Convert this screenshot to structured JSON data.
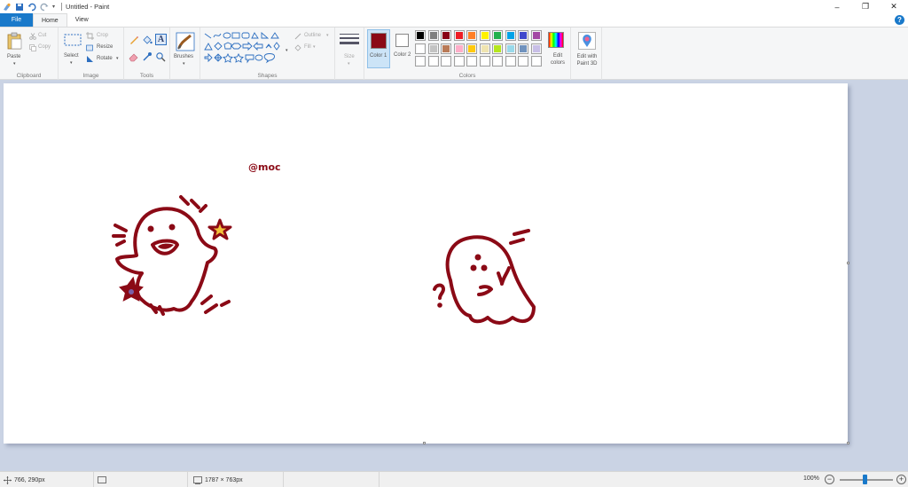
{
  "titlebar": {
    "title": "Untitled - Paint",
    "minimize": "–",
    "maximize": "❐",
    "close": "✕"
  },
  "tabs": {
    "file": "File",
    "home": "Home",
    "view": "View"
  },
  "ribbon": {
    "clipboard": {
      "label": "Clipboard",
      "paste": "Paste",
      "cut": "Cut",
      "copy": "Copy"
    },
    "image": {
      "label": "Image",
      "select": "Select",
      "crop": "Crop",
      "resize": "Resize",
      "rotate": "Rotate"
    },
    "tools": {
      "label": "Tools"
    },
    "brushes": {
      "label": "Brushes"
    },
    "shapes": {
      "label": "Shapes",
      "outline": "Outline",
      "fill": "Fill"
    },
    "size": {
      "label": "Size"
    },
    "colors": {
      "label": "Colors",
      "color1": "Color 1",
      "color2": "Color 2",
      "edit_colors": "Edit colors",
      "edit_3d": "Edit with Paint 3D",
      "color1_value": "#8b0a16",
      "color2_value": "#ffffff",
      "palette_row1": [
        "#000000",
        "#7f7f7f",
        "#880015",
        "#ed1c24",
        "#ff7f27",
        "#fff200",
        "#22b14c",
        "#00a2e8",
        "#3f48cc",
        "#a349a4"
      ],
      "palette_row2": [
        "#ffffff",
        "#c3c3c3",
        "#b97a57",
        "#ffaec9",
        "#ffc90e",
        "#efe4b0",
        "#b5e61d",
        "#99d9ea",
        "#7092be",
        "#c8bfe7"
      ],
      "palette_row3": [
        "#ffffff",
        "#ffffff",
        "#ffffff",
        "#ffffff",
        "#ffffff",
        "#ffffff",
        "#ffffff",
        "#ffffff",
        "#ffffff",
        "#ffffff"
      ]
    }
  },
  "canvas": {
    "text": "@moc",
    "stroke_color": "#8b0a16"
  },
  "status": {
    "cursor_pos": "766, 290px",
    "canvas_size": "1787 × 763px",
    "zoom": "100%"
  }
}
